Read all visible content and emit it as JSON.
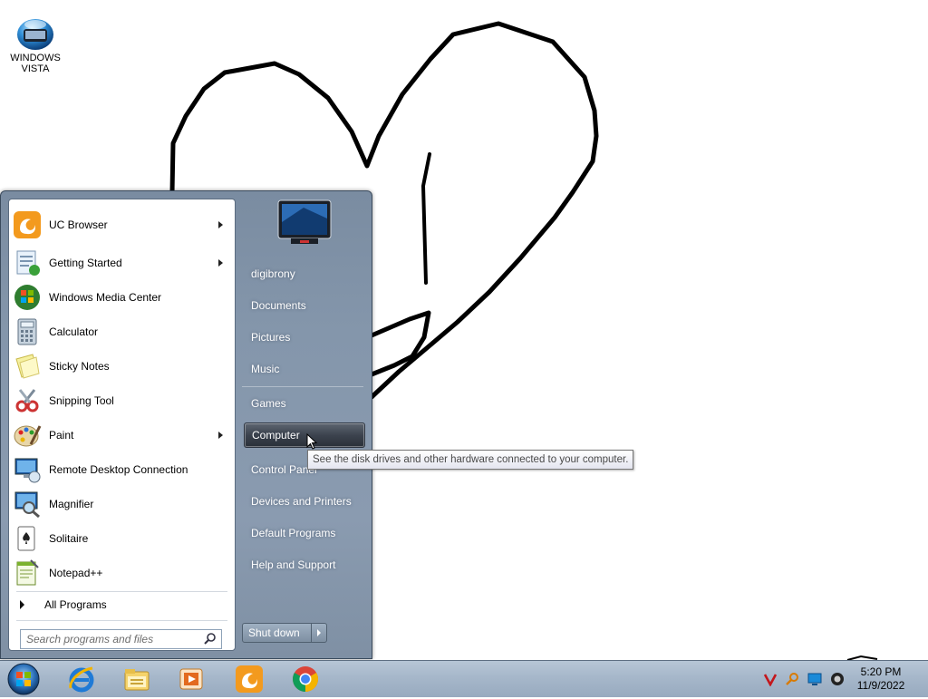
{
  "desktop": {
    "icon_label": "WINDOWS VISTA"
  },
  "start_menu": {
    "programs": [
      {
        "label": "UC Browser",
        "icon": "uc-browser-icon",
        "submenu": true
      },
      {
        "label": "Getting Started",
        "icon": "getting-started-icon",
        "submenu": true
      },
      {
        "label": "Windows Media Center",
        "icon": "media-center-icon",
        "submenu": false
      },
      {
        "label": "Calculator",
        "icon": "calculator-icon",
        "submenu": false
      },
      {
        "label": "Sticky Notes",
        "icon": "sticky-notes-icon",
        "submenu": false
      },
      {
        "label": "Snipping Tool",
        "icon": "snipping-tool-icon",
        "submenu": false
      },
      {
        "label": "Paint",
        "icon": "paint-icon",
        "submenu": true
      },
      {
        "label": "Remote Desktop Connection",
        "icon": "remote-desktop-icon",
        "submenu": false
      },
      {
        "label": "Magnifier",
        "icon": "magnifier-icon",
        "submenu": false
      },
      {
        "label": "Solitaire",
        "icon": "solitaire-icon",
        "submenu": false
      },
      {
        "label": "Notepad++",
        "icon": "notepadpp-icon",
        "submenu": false
      }
    ],
    "all_programs": "All Programs",
    "search_placeholder": "Search programs and files",
    "places": [
      {
        "label": "digibrony"
      },
      {
        "label": "Documents"
      },
      {
        "label": "Pictures"
      },
      {
        "label": "Music"
      },
      {
        "label": "Games"
      },
      {
        "label": "Computer",
        "highlighted": true
      },
      {
        "label": "Control Panel"
      },
      {
        "label": "Devices and Printers"
      },
      {
        "label": "Default Programs"
      },
      {
        "label": "Help and Support"
      }
    ],
    "shutdown_label": "Shut down"
  },
  "tooltip": "See the disk drives and other hardware connected to your computer.",
  "taskbar": {
    "pinned": [
      "internet-explorer-icon",
      "windows-explorer-icon",
      "media-player-icon",
      "uc-browser-icon",
      "chrome-icon"
    ],
    "tray_icons": [
      "v-shield-icon",
      "search-key-icon",
      "display-icon",
      "volume-icon"
    ],
    "clock_time": "5:20 PM",
    "clock_date": "11/9/2022"
  }
}
